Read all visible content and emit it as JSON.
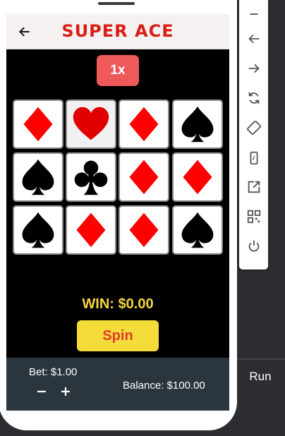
{
  "app": {
    "title": "SUPER ACE",
    "back_icon": "arrow-left-icon",
    "multiplier": "1x"
  },
  "reels": [
    [
      "diamond",
      "heart",
      "diamond",
      "spade"
    ],
    [
      "spade",
      "club",
      "diamond",
      "diamond"
    ],
    [
      "spade",
      "diamond",
      "diamond",
      "spade"
    ]
  ],
  "result": {
    "win_text": "WIN: $0.00"
  },
  "controls": {
    "spin_label": "Spin",
    "bet_text": "Bet: $1.00",
    "decrease_label": "−",
    "increase_label": "+",
    "balance_text": "Balance: $100.00"
  },
  "ide": {
    "run_label": "Run"
  },
  "emulator_toolbar": [
    "minimize-icon",
    "back-arrow-icon",
    "forward-arrow-icon",
    "rotate-icon",
    "rotate-device-icon",
    "device-icon",
    "open-external-icon",
    "qr-code-icon",
    "power-icon"
  ],
  "colors": {
    "title_red": "#d91e18",
    "red_suit": "#ff0000",
    "heart_red": "#e00000",
    "black_suit": "#000000",
    "multiplier_bg": "#ee5a5c",
    "win_yellow": "#f5d442",
    "spin_bg": "#f4dc3b",
    "spin_text": "#e23b2d",
    "footer_bg": "#2b353d"
  }
}
